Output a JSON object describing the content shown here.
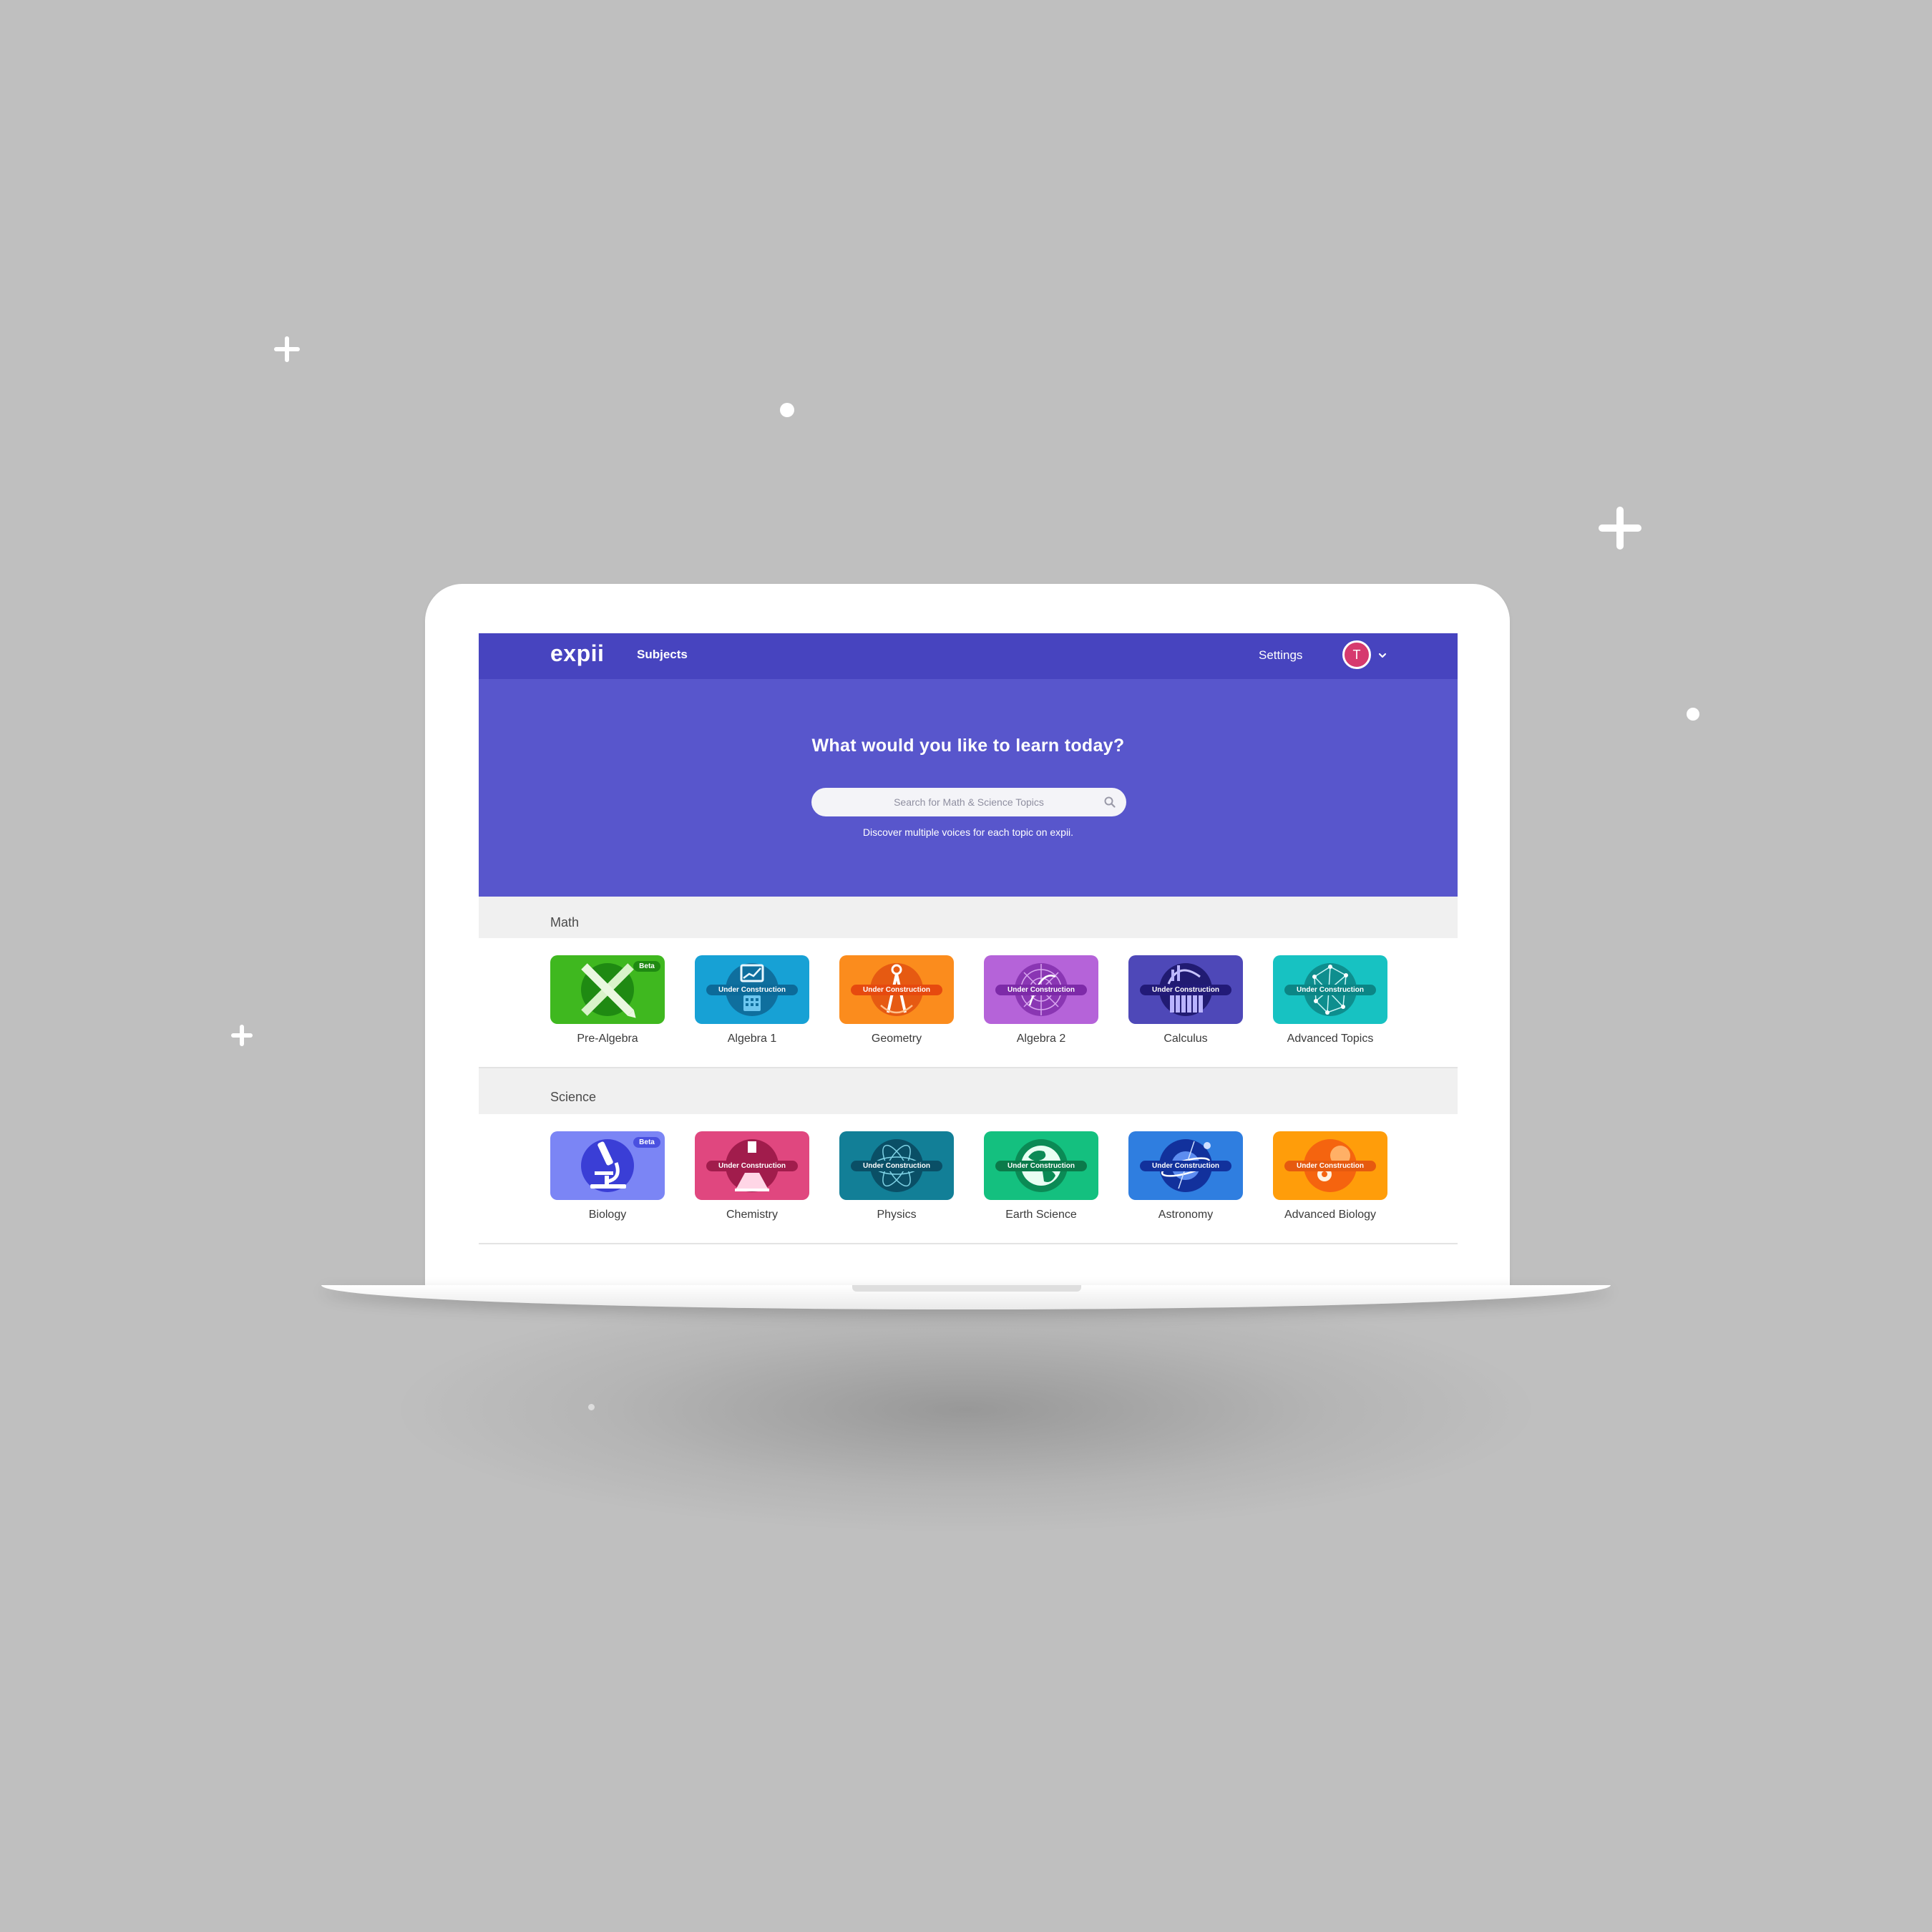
{
  "app": {
    "logo": "expii",
    "nav_subjects": "Subjects",
    "nav_settings": "Settings",
    "avatar_initial": "T"
  },
  "hero": {
    "title": "What would you like to learn today?",
    "search_placeholder": "Search for Math & Science Topics",
    "subtitle": "Discover multiple voices for each topic on expii."
  },
  "sections": [
    {
      "title": "Math",
      "tiles": [
        {
          "label": "Pre-Algebra",
          "badge": "Beta",
          "color": "#3fb81f",
          "icon": "crossed-ruler-pencil-icon"
        },
        {
          "label": "Algebra 1",
          "badge": "Under Construction",
          "color": "#17a1d5",
          "icon": "calculator-graph-icon"
        },
        {
          "label": "Geometry",
          "badge": "Under Construction",
          "color": "#fb8c1d",
          "icon": "compass-icon"
        },
        {
          "label": "Algebra 2",
          "badge": "Under Construction",
          "color": "#b563d9",
          "icon": "polar-graph-icon"
        },
        {
          "label": "Calculus",
          "badge": "Under Construction",
          "color": "#4e48b8",
          "icon": "integral-bars-icon"
        },
        {
          "label": "Advanced Topics",
          "badge": "Under Construction",
          "color": "#17c2c2",
          "icon": "network-graph-icon"
        }
      ]
    },
    {
      "title": "Science",
      "tiles": [
        {
          "label": "Biology",
          "badge": "Beta",
          "color": "#7b85f5",
          "icon": "microscope-icon"
        },
        {
          "label": "Chemistry",
          "badge": "Under Construction",
          "color": "#e0477f",
          "icon": "beaker-icon"
        },
        {
          "label": "Physics",
          "badge": "Under Construction",
          "color": "#127f97",
          "icon": "atom-icon"
        },
        {
          "label": "Earth Science",
          "badge": "Under Construction",
          "color": "#14c07f",
          "icon": "globe-icon"
        },
        {
          "label": "Astronomy",
          "badge": "Under Construction",
          "color": "#2f7ee0",
          "icon": "planet-icon"
        },
        {
          "label": "Advanced Biology",
          "badge": "Under Construction",
          "color": "#ff9d0a",
          "icon": "cell-icon"
        }
      ]
    }
  ]
}
